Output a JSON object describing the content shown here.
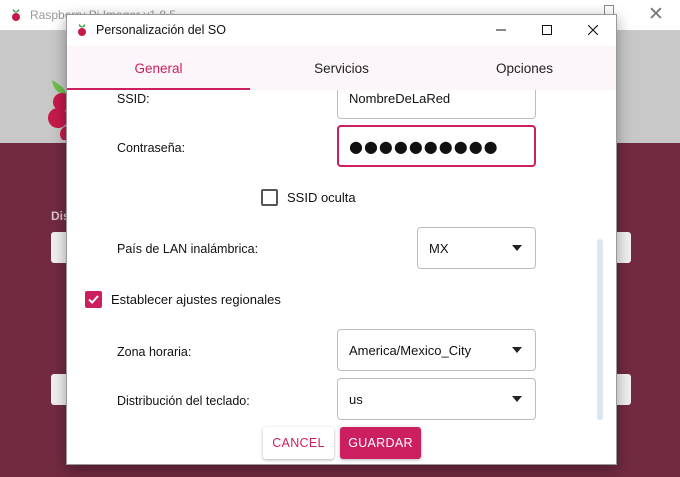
{
  "background": {
    "title": "Raspberry Pi Imager v1.8.5",
    "section_label": "Dis"
  },
  "dialog": {
    "title": "Personalización del SO",
    "tabs": [
      {
        "label": "General",
        "active": true
      },
      {
        "label": "Servicios",
        "active": false
      },
      {
        "label": "Opciones",
        "active": false
      }
    ],
    "wifi": {
      "ssid_label": "SSID:",
      "ssid_value": "NombreDeLaRed",
      "password_label": "Contraseña:",
      "password_value": "●●●●●●●●●●",
      "hidden_ssid_label": "SSID oculta",
      "hidden_ssid_checked": false,
      "country_label": "País de LAN inalámbrica:",
      "country_value": "MX"
    },
    "locale": {
      "enable_label": "Establecer ajustes regionales",
      "enable_checked": true,
      "timezone_label": "Zona horaria:",
      "timezone_value": "America/Mexico_City",
      "keyboard_label": "Distribución del teclado:",
      "keyboard_value": "us"
    },
    "buttons": {
      "cancel": "CANCEL",
      "save": "GUARDAR"
    }
  },
  "colors": {
    "accent": "#cb1f5f",
    "background_maroon": "#722a41",
    "tab_bar": "#fcf5f9"
  },
  "icons": [
    "raspberry-icon",
    "minimize-icon",
    "maximize-icon",
    "close-icon",
    "chevron-down-icon",
    "checkmark-icon"
  ]
}
